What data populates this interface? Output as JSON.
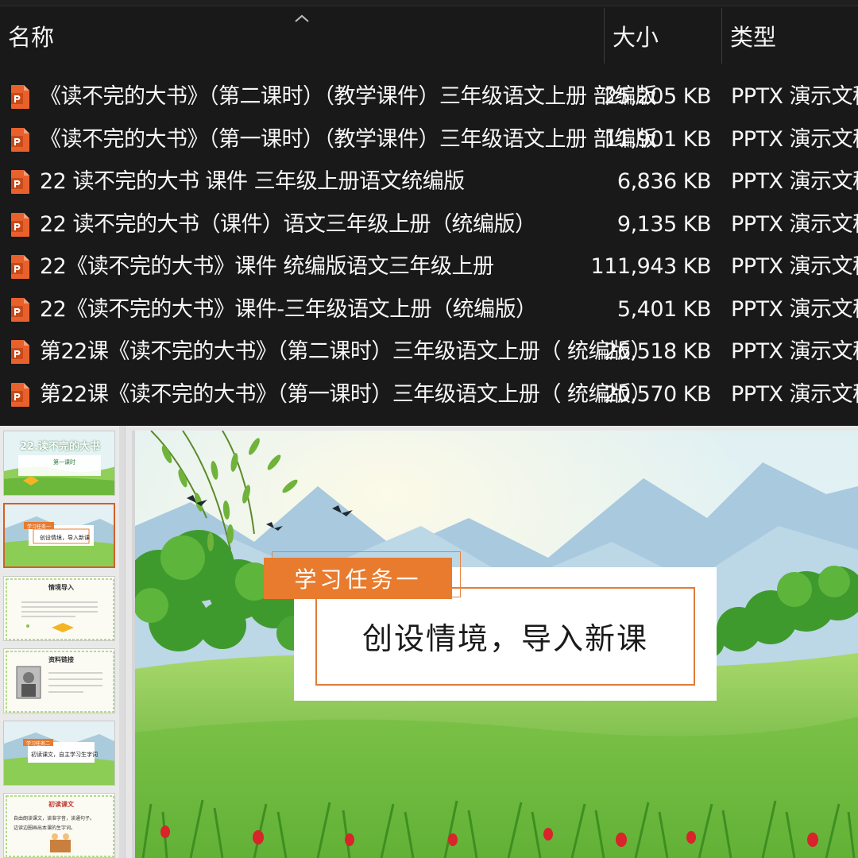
{
  "explorer": {
    "columns": {
      "name": "名称",
      "size": "大小",
      "type": "类型"
    },
    "files": [
      {
        "name": "《读不完的大书》（第二课时）（教学课件）三年级语文上册 部编版",
        "size": "25,205 KB",
        "type": "PPTX 演示文稿"
      },
      {
        "name": "《读不完的大书》（第一课时）（教学课件）三年级语文上册 部编版",
        "size": "11,901 KB",
        "type": "PPTX 演示文稿"
      },
      {
        "name": "22 读不完的大书 课件 三年级上册语文统编版",
        "size": "6,836 KB",
        "type": "PPTX 演示文稿"
      },
      {
        "name": "22 读不完的大书（课件）语文三年级上册（统编版）",
        "size": "9,135 KB",
        "type": "PPTX 演示文稿"
      },
      {
        "name": "22《读不完的大书》课件 统编版语文三年级上册",
        "size": "111,943 KB",
        "type": "PPTX 演示文稿"
      },
      {
        "name": "22《读不完的大书》课件-三年级语文上册（统编版）",
        "size": "5,401 KB",
        "type": "PPTX 演示文稿"
      },
      {
        "name": "第22课《读不完的大书》（第二课时）三年级语文上册（ 统编版）",
        "size": "26,518 KB",
        "type": "PPTX 演示文稿"
      },
      {
        "name": "第22课《读不完的大书》（第一课时）三年级语文上册（ 统编版）",
        "size": "20,570 KB",
        "type": "PPTX 演示文稿"
      }
    ]
  },
  "thumbnails": [
    {
      "title": "22.读不完的大书",
      "sub": "第一课时"
    },
    {
      "tag": "学习任务一",
      "text": "创设情境，导入新课"
    },
    {
      "title": "情境导入"
    },
    {
      "title": "资料链接"
    },
    {
      "tag": "学习任务二",
      "text": "初读课文，自主学习生字词"
    },
    {
      "title": "初读课文",
      "text": "自由朗读课文，读准字音，读通句子。",
      "text2": "边读边圈画出本课的生字词。"
    }
  ],
  "slide": {
    "tag": "学习任务一",
    "title": "创设情境，导入新课"
  },
  "colors": {
    "accent": "#e87b2e",
    "explorer_bg": "#191919",
    "pptx_icon": "#e8612c"
  },
  "icons": {
    "file": "pptx-file-icon",
    "sort": "sort-ascending-caret-icon"
  }
}
